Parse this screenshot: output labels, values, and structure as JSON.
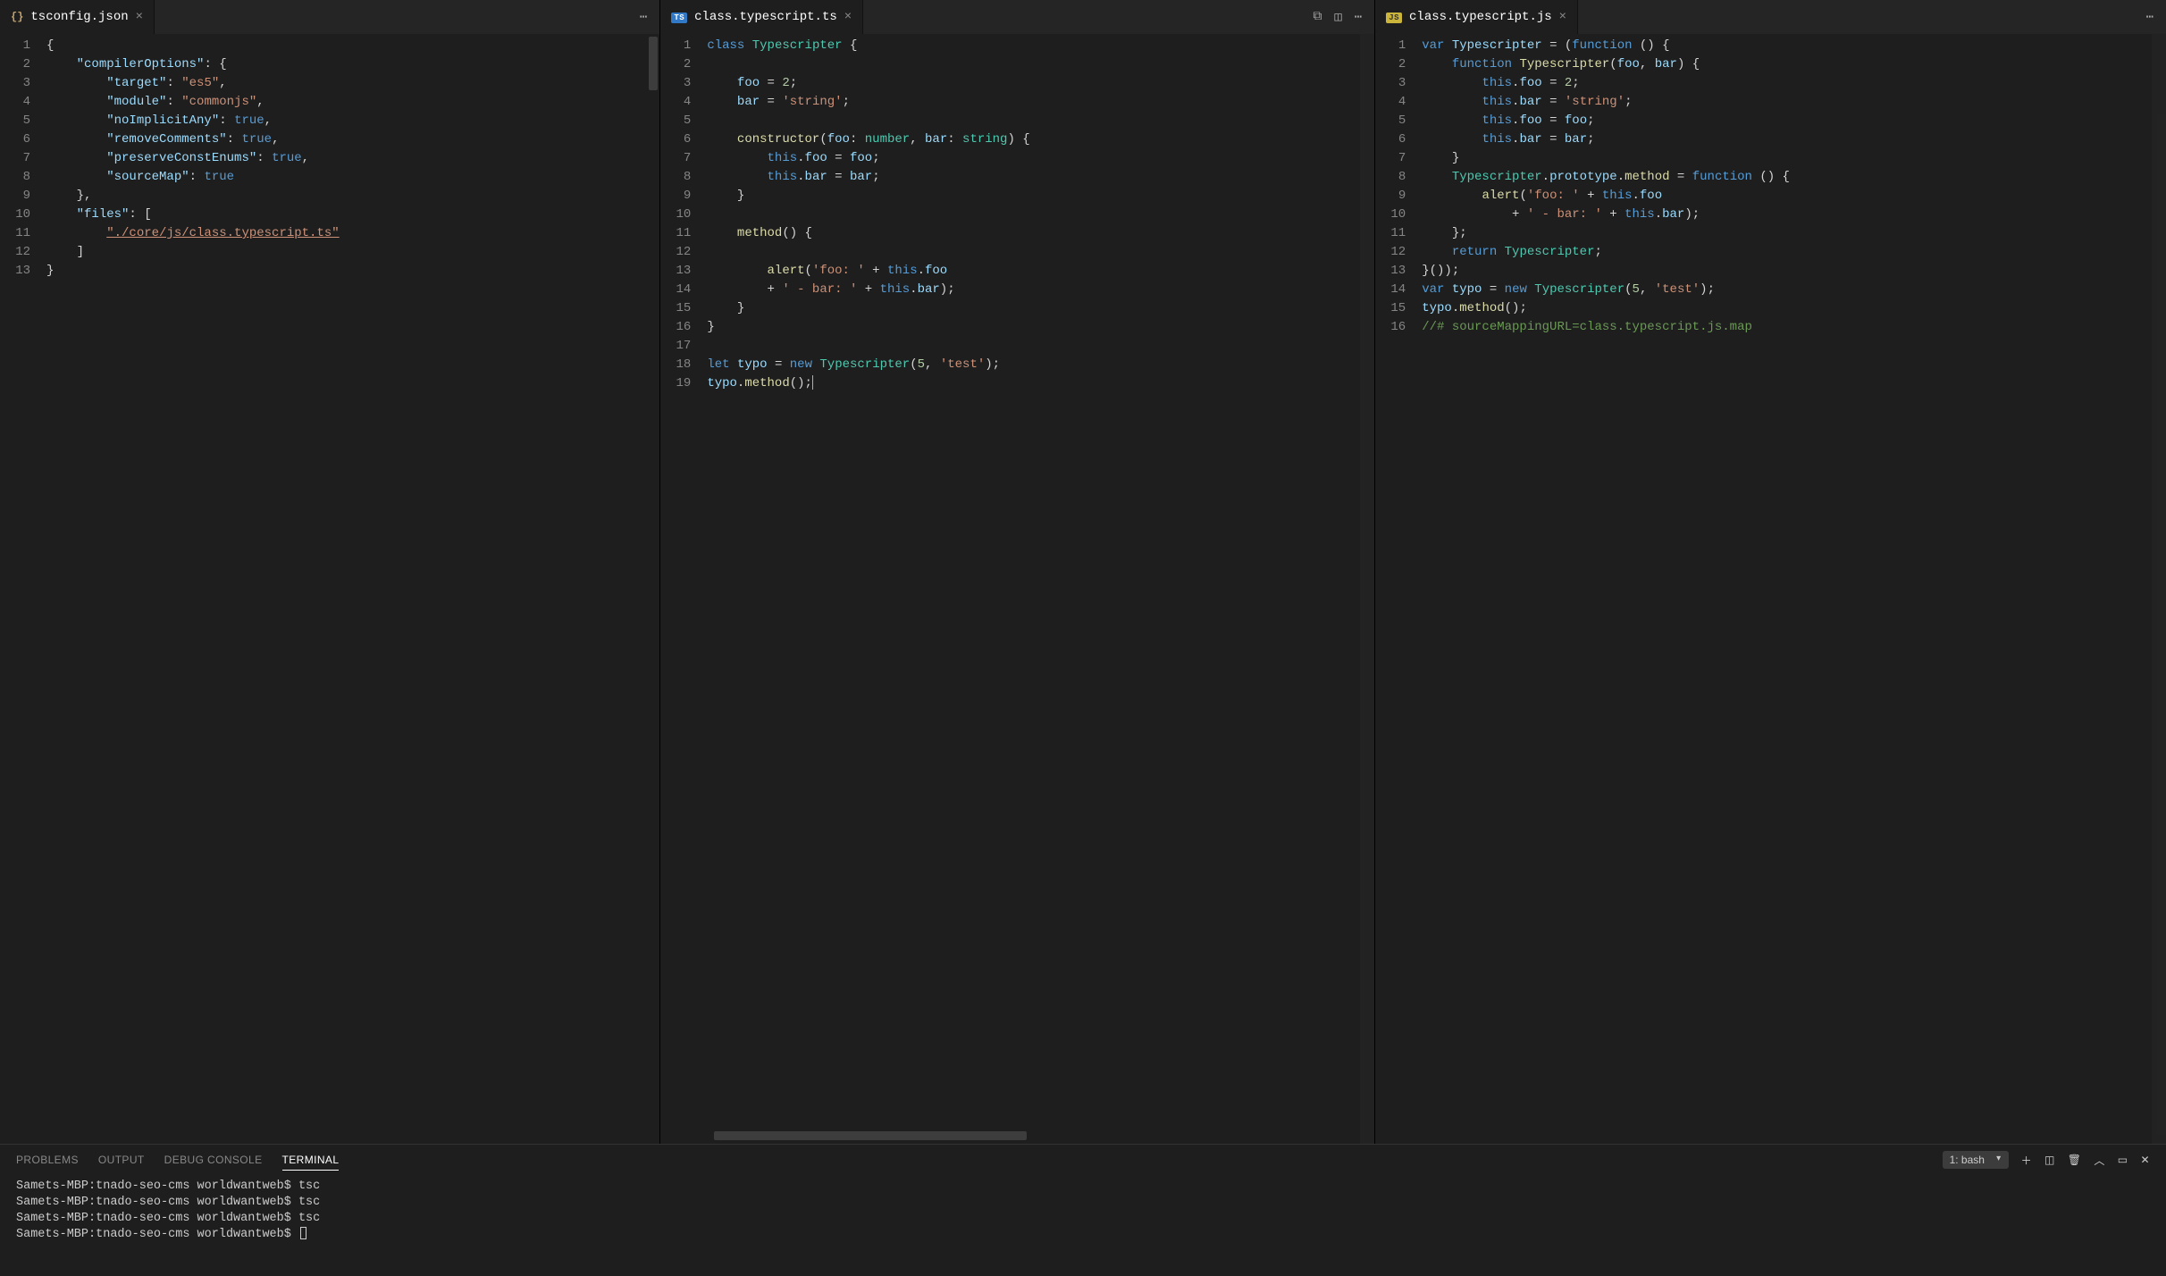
{
  "panes": [
    {
      "id": "pane1",
      "tab": {
        "icon": "braces-icon",
        "iconClass": "file-icon-braces",
        "iconText": "{}",
        "filename": "tsconfig.json"
      },
      "actions": [
        "more-icon"
      ],
      "lineCount": 13,
      "codeHTML": [
        "<span class='tk-punc'>{</span>",
        "    <span class='j-key'>\"compilerOptions\"</span>: {",
        "        <span class='j-key'>\"target\"</span>: <span class='j-str'>\"es5\"</span>,",
        "        <span class='j-key'>\"module\"</span>: <span class='j-str'>\"commonjs\"</span>,",
        "        <span class='j-key'>\"noImplicitAny\"</span>: <span class='j-bool'>true</span>,",
        "        <span class='j-key'>\"removeComments\"</span>: <span class='j-bool'>true</span>,",
        "        <span class='j-key'>\"preserveConstEnums\"</span>: <span class='j-bool'>true</span>,",
        "        <span class='j-key'>\"sourceMap\"</span>: <span class='j-bool'>true</span>",
        "    },",
        "    <span class='j-key'>\"files\"</span>: [",
        "        <span class='j-str' style='text-decoration:underline'>\"./core/js/class.typescript.ts\"</span>",
        "    ]",
        "<span class='tk-punc'>}</span>"
      ]
    },
    {
      "id": "pane2",
      "tab": {
        "icon": "ts-icon",
        "iconClass": "file-icon-ts",
        "iconText": "TS",
        "filename": "class.typescript.ts"
      },
      "actions": [
        "compare-icon",
        "split-icon",
        "more-icon"
      ],
      "lineCount": 19,
      "codeHTML": [
        "<span class='tk-key'>class</span> <span class='tk-type'>Typescripter</span> {",
        "",
        "    <span class='tk-prop'>foo</span> = <span class='tk-num'>2</span>;",
        "    <span class='tk-prop'>bar</span> = <span class='tk-str'>'string'</span>;",
        "",
        "    <span class='tk-func'>constructor</span>(<span class='tk-prop'>foo</span>: <span class='tk-type'>number</span>, <span class='tk-prop'>bar</span>: <span class='tk-type'>string</span>) {",
        "        <span class='tk-key'>this</span>.<span class='tk-prop'>foo</span> = <span class='tk-prop'>foo</span>;",
        "        <span class='tk-key'>this</span>.<span class='tk-prop'>bar</span> = <span class='tk-prop'>bar</span>;",
        "    }",
        "",
        "    <span class='tk-func'>method</span>() {",
        "",
        "        <span class='tk-func'>alert</span>(<span class='tk-str'>'foo: '</span> + <span class='tk-key'>this</span>.<span class='tk-prop'>foo</span>",
        "        + <span class='tk-str'>' - bar: '</span> + <span class='tk-key'>this</span>.<span class='tk-prop'>bar</span>);",
        "    }",
        "}",
        "",
        "<span class='tk-key'>let</span> <span class='tk-prop'>typo</span> = <span class='tk-key'>new</span> <span class='tk-type'>Typescripter</span>(<span class='tk-num'>5</span>, <span class='tk-str'>'test'</span>);",
        "<span class='tk-prop'>typo</span>.<span class='tk-func'>method</span>();<span class='caret-line'></span>"
      ]
    },
    {
      "id": "pane3",
      "tab": {
        "icon": "js-icon",
        "iconClass": "file-icon-js",
        "iconText": "JS",
        "filename": "class.typescript.js"
      },
      "actions": [
        "more-icon"
      ],
      "lineCount": 16,
      "codeHTML": [
        "<span class='tk-key'>var</span> <span class='tk-prop'>Typescripter</span> = (<span class='tk-key'>function</span> () {",
        "    <span class='tk-key'>function</span> <span class='tk-func'>Typescripter</span>(<span class='tk-prop'>foo</span>, <span class='tk-prop'>bar</span>) {",
        "        <span class='tk-key'>this</span>.<span class='tk-prop'>foo</span> = <span class='tk-num'>2</span>;",
        "        <span class='tk-key'>this</span>.<span class='tk-prop'>bar</span> = <span class='tk-str'>'string'</span>;",
        "        <span class='tk-key'>this</span>.<span class='tk-prop'>foo</span> = <span class='tk-prop'>foo</span>;",
        "        <span class='tk-key'>this</span>.<span class='tk-prop'>bar</span> = <span class='tk-prop'>bar</span>;",
        "    }",
        "    <span class='tk-type'>Typescripter</span>.<span class='tk-prop'>prototype</span>.<span class='tk-func'>method</span> = <span class='tk-key'>function</span> () {",
        "        <span class='tk-func'>alert</span>(<span class='tk-str'>'foo: '</span> + <span class='tk-key'>this</span>.<span class='tk-prop'>foo</span>",
        "            + <span class='tk-str'>' - bar: '</span> + <span class='tk-key'>this</span>.<span class='tk-prop'>bar</span>);",
        "    };",
        "    <span class='tk-key'>return</span> <span class='tk-type'>Typescripter</span>;",
        "}());",
        "<span class='tk-key'>var</span> <span class='tk-prop'>typo</span> = <span class='tk-key'>new</span> <span class='tk-type'>Typescripter</span>(<span class='tk-num'>5</span>, <span class='tk-str'>'test'</span>);",
        "<span class='tk-prop'>typo</span>.<span class='tk-func'>method</span>();",
        "<span class='tk-comment'>//# sourceMappingURL=class.typescript.js.map</span>"
      ]
    }
  ],
  "panel": {
    "tabs": [
      "PROBLEMS",
      "OUTPUT",
      "DEBUG CONSOLE",
      "TERMINAL"
    ],
    "activeTab": 3,
    "terminalSelect": "1: bash",
    "lines": [
      "Samets-MBP:tnado-seo-cms worldwantweb$ tsc",
      "Samets-MBP:tnado-seo-cms worldwantweb$ tsc",
      "Samets-MBP:tnado-seo-cms worldwantweb$ tsc",
      "Samets-MBP:tnado-seo-cms worldwantweb$ "
    ]
  },
  "icons": {
    "more": "⋯",
    "split": "◫",
    "compare": "⧉",
    "plus": "＋",
    "trash": "🗑",
    "chevUp": "︿",
    "maximize": "▭",
    "close": "✕"
  }
}
